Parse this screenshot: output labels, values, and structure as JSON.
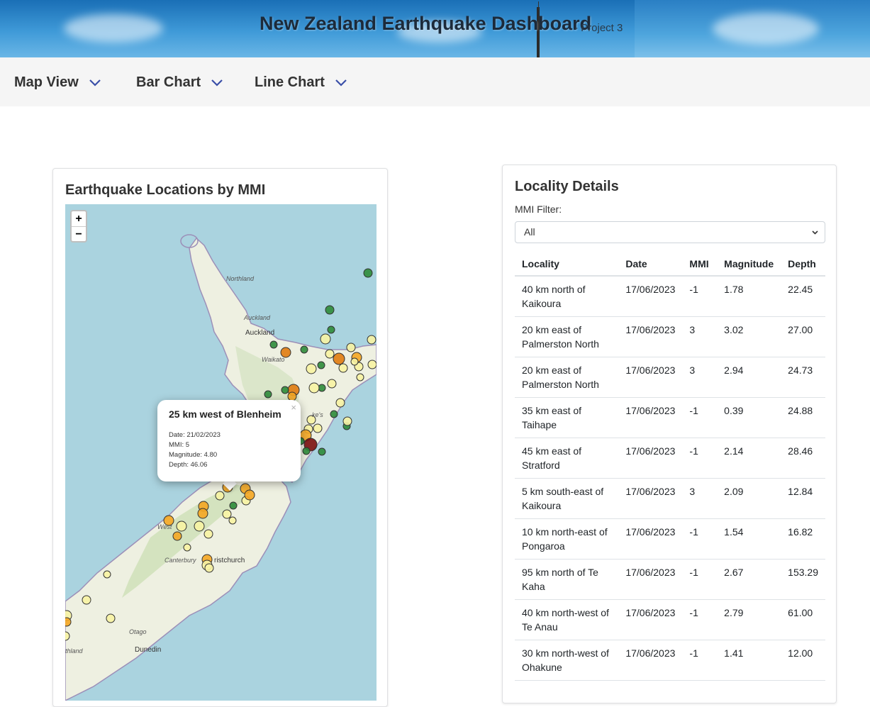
{
  "header": {
    "title": "New Zealand Earthquake Dashboard",
    "subtitle": "- Project 3"
  },
  "nav": {
    "items": [
      {
        "label": "Map View",
        "icon": "chevron-down-icon"
      },
      {
        "label": "Bar Chart",
        "icon": "chevron-down-icon"
      },
      {
        "label": "Line Chart",
        "icon": "chevron-down-icon"
      }
    ]
  },
  "map_card": {
    "title": "Earthquake Locations by MMI",
    "zoom_in": "+",
    "zoom_out": "−",
    "labels": {
      "northland": "Northland",
      "auckland_region": "Auckland",
      "auckland_city": "Auckland",
      "waikato": "Waikato",
      "hawkes": "ke's",
      "west": "West",
      "canterbury": "Canterbury",
      "christchurch": "ristchurch",
      "otago": "Otago",
      "dunedin": "Dunedin",
      "southland": "thland"
    },
    "popup": {
      "title": "25 km west of Blenheim",
      "close": "×",
      "date_line": "Date: 21/02/2023",
      "mmi_line": "MMI: 5",
      "magnitude_line": "Magnitude: 4.80",
      "depth_line": "Depth: 46.06"
    },
    "colors": {
      "sea": "#aad3df",
      "land": "#eef0e1",
      "mmi_neg": "#f7f3a3",
      "mmi_low": "#2e8b3a",
      "mmi_mid": "#f4a622",
      "mmi_high": "#e07b10",
      "mmi_severe": "#7b1010"
    }
  },
  "details": {
    "title": "Locality Details",
    "filter_label": "MMI Filter:",
    "filter_value": "All",
    "columns": [
      "Locality",
      "Date",
      "MMI",
      "Magnitude",
      "Depth"
    ],
    "rows": [
      [
        "40 km north of Kaikoura",
        "17/06/2023",
        "-1",
        "1.78",
        "22.45"
      ],
      [
        "20 km east of Palmerston North",
        "17/06/2023",
        "3",
        "3.02",
        "27.00"
      ],
      [
        "20 km east of Palmerston North",
        "17/06/2023",
        "3",
        "2.94",
        "24.73"
      ],
      [
        "35 km east of Taihape",
        "17/06/2023",
        "-1",
        "0.39",
        "24.88"
      ],
      [
        "45 km east of Stratford",
        "17/06/2023",
        "-1",
        "2.14",
        "28.46"
      ],
      [
        "5 km south-east of Kaikoura",
        "17/06/2023",
        "3",
        "2.09",
        "12.84"
      ],
      [
        "10 km north-east of Pongaroa",
        "17/06/2023",
        "-1",
        "1.54",
        "16.82"
      ],
      [
        "95 km north of Te Kaha",
        "17/06/2023",
        "-1",
        "2.67",
        "153.29"
      ],
      [
        "40 km north-west of Te Anau",
        "17/06/2023",
        "-1",
        "2.79",
        "61.00"
      ],
      [
        "30 km north-west of Ohakune",
        "17/06/2023",
        "-1",
        "1.41",
        "12.00"
      ]
    ]
  }
}
